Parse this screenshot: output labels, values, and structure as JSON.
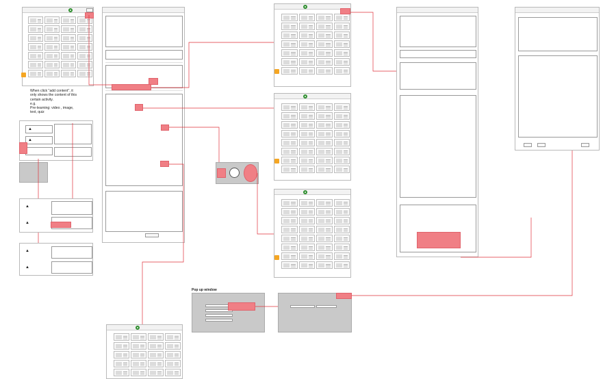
{
  "annotation": {
    "note": "When click \"add content\", it only shows the content of this certain activity.\ne.g.\nPre-learning: video , image, text, quiz"
  },
  "popup_section": {
    "title": "Pop up window"
  },
  "colors": {
    "highlight": "#f07f85",
    "connector": "#e0303a",
    "dialog_grey": "#c9c9c9",
    "nav_selected": "#f3e04a",
    "arrow_icon": "#f5a623",
    "logo_ring": "#2f8f2f"
  },
  "icons": [
    "arrow-icon",
    "pin-icon",
    "plus-icon",
    "logo-icon",
    "arrow-badge-icon"
  ]
}
